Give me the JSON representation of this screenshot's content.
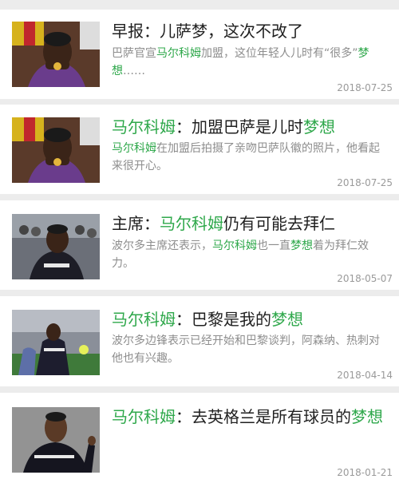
{
  "articles": [
    {
      "title_parts": [
        {
          "t": "早报：儿萨梦，这次不改了",
          "hl": false
        }
      ],
      "summary_parts": [
        {
          "t": "巴萨官宣",
          "hl": false
        },
        {
          "t": "马尔科姆",
          "hl": true
        },
        {
          "t": "加盟，这位年轻人儿时有“很多”",
          "hl": false
        },
        {
          "t": "梦想",
          "hl": true
        },
        {
          "t": "……",
          "hl": false
        }
      ],
      "date": "2018-07-25",
      "thumbnail": "player-kissing-badge-photo"
    },
    {
      "title_parts": [
        {
          "t": "马尔科姆",
          "hl": true
        },
        {
          "t": "：加盟巴萨是儿时",
          "hl": false
        },
        {
          "t": "梦想",
          "hl": true
        }
      ],
      "summary_parts": [
        {
          "t": "马尔科姆",
          "hl": true
        },
        {
          "t": "在加盟后拍摄了亲吻巴萨队徽的照片，他看起来很开心。",
          "hl": false
        }
      ],
      "date": "2018-07-25",
      "thumbnail": "player-kissing-badge-photo"
    },
    {
      "title_parts": [
        {
          "t": "主席：",
          "hl": false
        },
        {
          "t": "马尔科姆",
          "hl": true
        },
        {
          "t": "仍有可能去拜仁",
          "hl": false
        }
      ],
      "summary_parts": [
        {
          "t": "波尔多主席还表示，",
          "hl": false
        },
        {
          "t": "马尔科姆",
          "hl": true
        },
        {
          "t": "也一直",
          "hl": false
        },
        {
          "t": "梦想",
          "hl": true
        },
        {
          "t": "着为拜仁效力。",
          "hl": false
        }
      ],
      "date": "2018-05-07",
      "thumbnail": "player-bordeaux-jersey-photo"
    },
    {
      "title_parts": [
        {
          "t": "马尔科姆",
          "hl": true
        },
        {
          "t": "：巴黎是我的",
          "hl": false
        },
        {
          "t": "梦想",
          "hl": true
        }
      ],
      "summary_parts": [
        {
          "t": "波尔多边锋表示已经开始和巴黎谈判，阿森纳、热刺对他也有兴趣。",
          "hl": false
        }
      ],
      "date": "2018-04-14",
      "thumbnail": "player-match-action-photo"
    },
    {
      "title_parts": [
        {
          "t": "马尔科姆",
          "hl": true
        },
        {
          "t": "：去英格兰是所有球员的",
          "hl": false
        },
        {
          "t": "梦想",
          "hl": true
        }
      ],
      "summary_parts": [],
      "date": "2018-01-21",
      "thumbnail": "player-celebrating-photo"
    }
  ],
  "colors": {
    "highlight": "#2fa84b",
    "title": "#1f1f1f",
    "summary": "#8d8d8d",
    "date": "#9a9a9a",
    "separator": "#ececec"
  }
}
